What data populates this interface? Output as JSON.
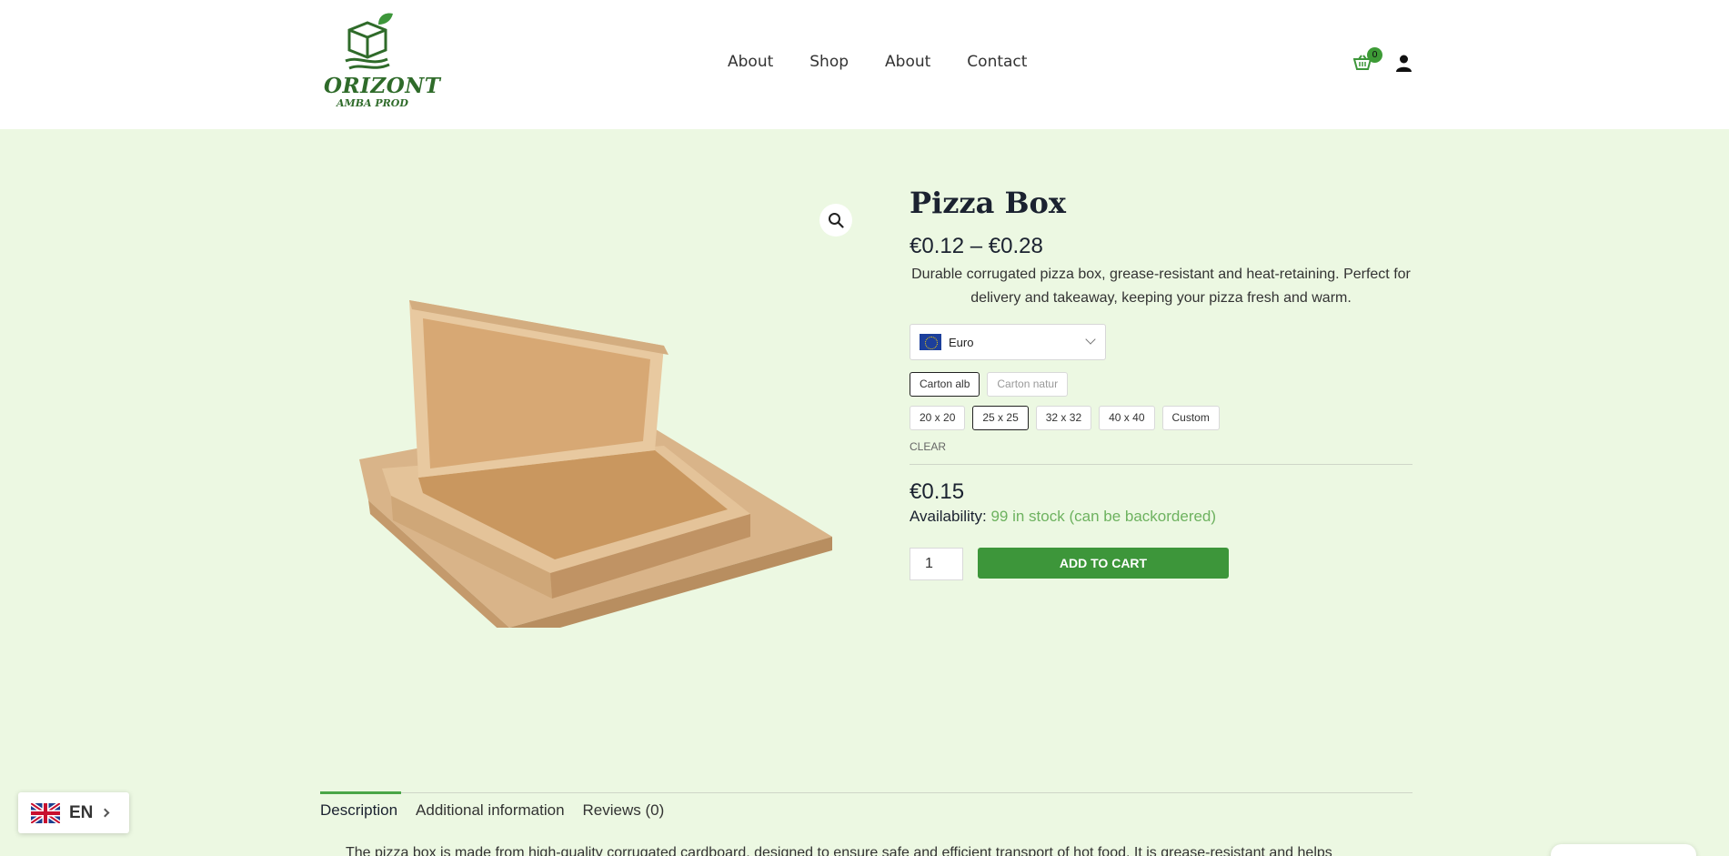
{
  "header": {
    "logo": {
      "brand": "ORIZONT",
      "sub": "AMBA PROD"
    },
    "nav": [
      "About",
      "Shop",
      "About",
      "Contact"
    ],
    "cart_count": "0"
  },
  "product": {
    "title": "Pizza Box",
    "price_range": "€0.12 – €0.28",
    "short_description": "Durable corrugated pizza box, grease-resistant and heat-retaining. Perfect for delivery and takeaway, keeping your pizza fresh and warm.",
    "currency": {
      "selected": "Euro"
    },
    "materials": [
      {
        "label": "Carton alb",
        "state": "selected"
      },
      {
        "label": "Carton natur",
        "state": "muted"
      }
    ],
    "sizes": [
      {
        "label": "20 x 20",
        "state": ""
      },
      {
        "label": "25 x 25",
        "state": "selected"
      },
      {
        "label": "32 x 32",
        "state": ""
      },
      {
        "label": "40 x 40",
        "state": ""
      },
      {
        "label": "Custom",
        "state": ""
      }
    ],
    "clear_label": "CLEAR",
    "variation_price": "€0.15",
    "availability_label": "Availability:",
    "availability_value": "99 in stock (can be backordered)",
    "quantity": "1",
    "add_to_cart": "ADD TO CART"
  },
  "tabs": [
    {
      "label": "Description"
    },
    {
      "label": "Additional information"
    },
    {
      "label": "Reviews (0)"
    }
  ],
  "description_text": "The pizza box is made from high-quality corrugated cardboard, designed to ensure safe and efficient transport of hot food. It is grease-resistant and helps",
  "language": {
    "code": "EN"
  },
  "colors": {
    "accent": "#3d963a",
    "background": "#ecf8e2",
    "stock": "#6db25f"
  }
}
